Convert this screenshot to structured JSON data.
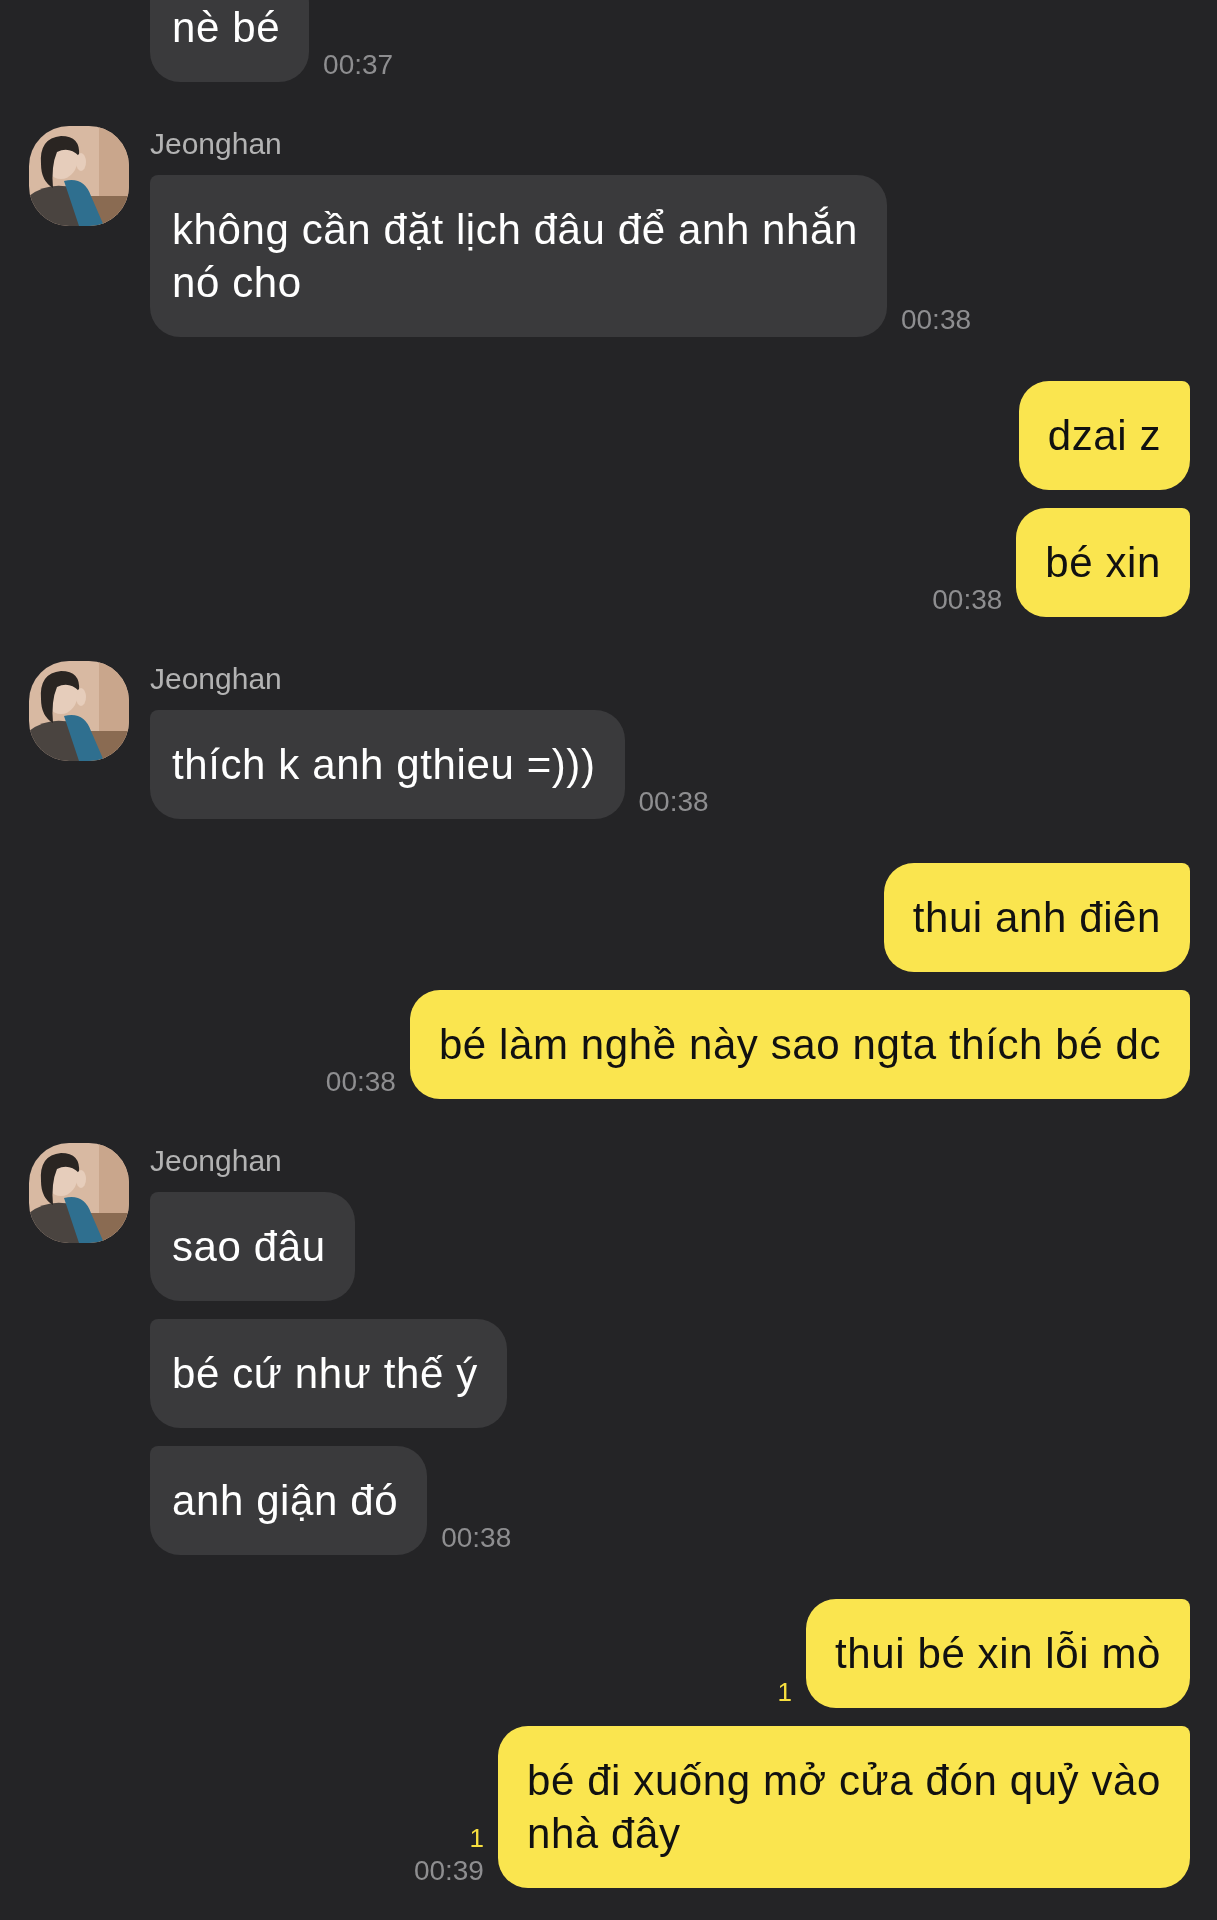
{
  "chat": [
    {
      "kind": "incoming",
      "messages": [
        {
          "text": "nè bé",
          "time": "00:37"
        }
      ]
    },
    {
      "kind": "incoming",
      "sender": "Jeonghan",
      "avatar": {
        "kind": "picture"
      },
      "messages": [
        {
          "text": "không cần đặt lịch đâu để anh nhắn\nnó cho",
          "time": "00:38"
        }
      ]
    },
    {
      "kind": "outgoing",
      "messages": [
        {
          "text": "dzai z"
        },
        {
          "text": "bé xin",
          "time": "00:38"
        }
      ]
    },
    {
      "kind": "incoming",
      "sender": "Jeonghan",
      "avatar": {
        "kind": "picture"
      },
      "messages": [
        {
          "text": "thích k anh gthieu =)))",
          "time": "00:38"
        }
      ]
    },
    {
      "kind": "outgoing",
      "messages": [
        {
          "text": "thui anh điên"
        },
        {
          "text": "bé làm nghề này sao ngta thích bé dc",
          "time": "00:38"
        }
      ]
    },
    {
      "kind": "incoming",
      "sender": "Jeonghan",
      "avatar": {
        "kind": "picture"
      },
      "messages": [
        {
          "text": "sao đâu"
        },
        {
          "text": "bé cứ như thế ý"
        },
        {
          "text": "anh giận đó",
          "time": "00:38"
        }
      ]
    },
    {
      "kind": "outgoing",
      "messages": [
        {
          "text": "thui bé xin lỗi mò",
          "unread": "1"
        },
        {
          "text": "bé đi xuống mở cửa đón quỷ vào\nnhà đây",
          "unread": "1",
          "time": "00:39"
        }
      ]
    }
  ]
}
